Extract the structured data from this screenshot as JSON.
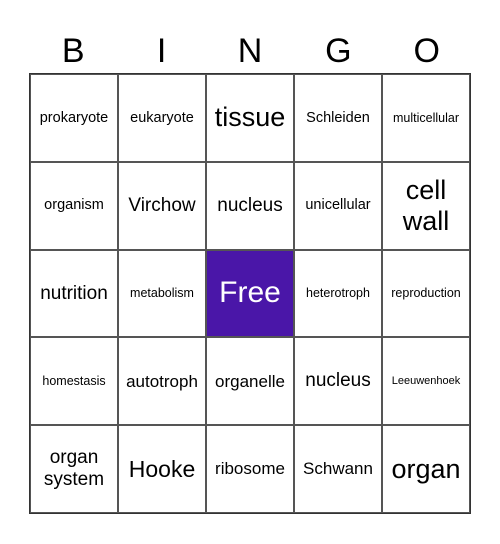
{
  "header": [
    "B",
    "I",
    "N",
    "G",
    "O"
  ],
  "free_color": "#4a16a8",
  "cells": [
    "prokaryote",
    "eukaryote",
    "tissue",
    "Schleiden",
    "multicellular",
    "organism",
    "Virchow",
    "nucleus",
    "unicellular",
    "cell wall",
    "nutrition",
    "metabolism",
    "Free",
    "heterotroph",
    "reproduction",
    "homestasis",
    "autotroph",
    "organelle",
    "nucleus",
    "Leeuwenhoek",
    "organ system",
    "Hooke",
    "ribosome",
    "Schwann",
    "organ"
  ]
}
